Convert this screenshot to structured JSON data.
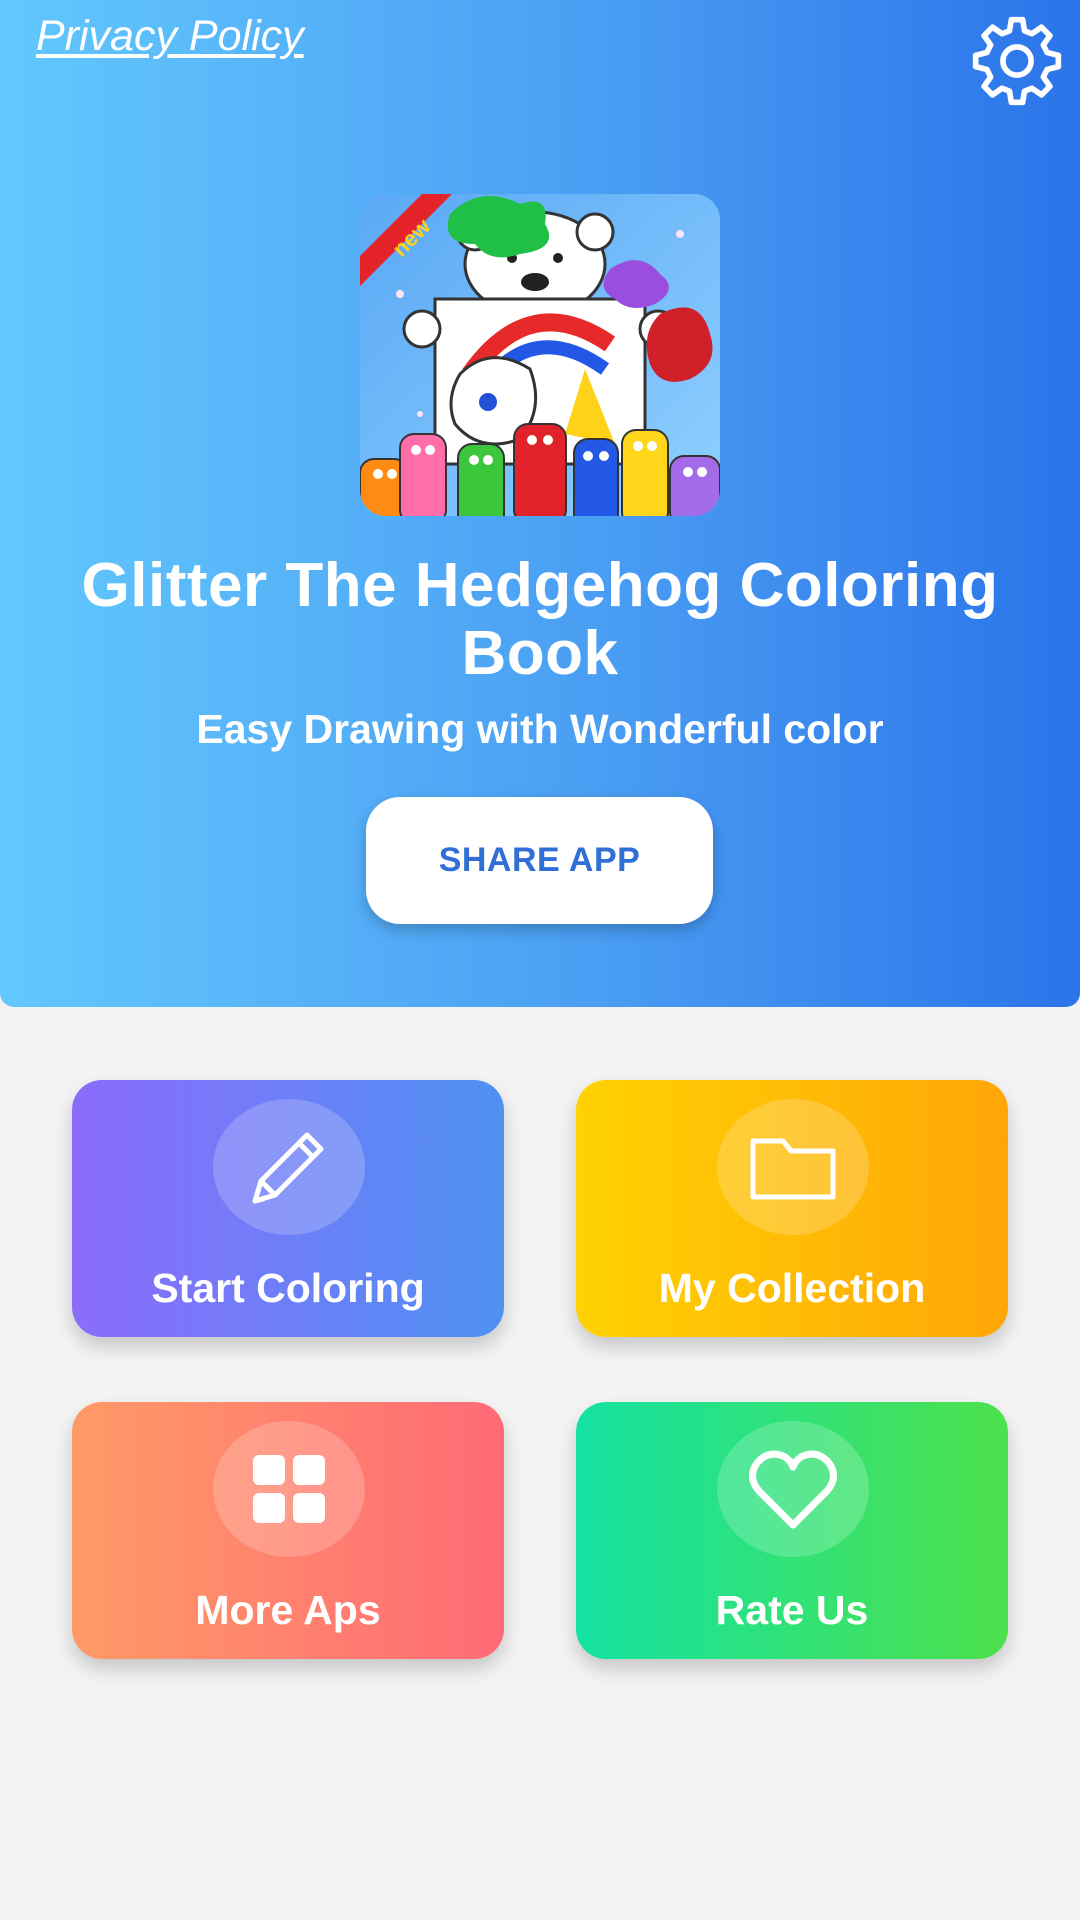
{
  "header": {
    "privacy_label": "Privacy Policy",
    "settings_icon": "gear-icon",
    "title": "Glitter The Hedgehog Coloring Book",
    "subtitle": "Easy Drawing with Wonderful color",
    "share_label": "SHARE APP",
    "app_icon_badge": "new"
  },
  "menu": {
    "tiles": [
      {
        "label": "Start Coloring",
        "icon": "pencil-icon",
        "colors": [
          "#8b6cfb",
          "#4f91f3"
        ]
      },
      {
        "label": "My Collection",
        "icon": "folder-icon",
        "colors": [
          "#ffd204",
          "#ffa607"
        ]
      },
      {
        "label": "More Aps",
        "icon": "grid-icon",
        "colors": [
          "#ff9a66",
          "#ff6a76"
        ]
      },
      {
        "label": "Rate Us",
        "icon": "heart-icon",
        "colors": [
          "#14e2a2",
          "#4de14c"
        ]
      }
    ]
  },
  "colors": {
    "header_gradient": [
      "#62c8fd",
      "#2b74ea"
    ],
    "share_text": "#2f6fd6",
    "background": "#f3f3f3"
  }
}
